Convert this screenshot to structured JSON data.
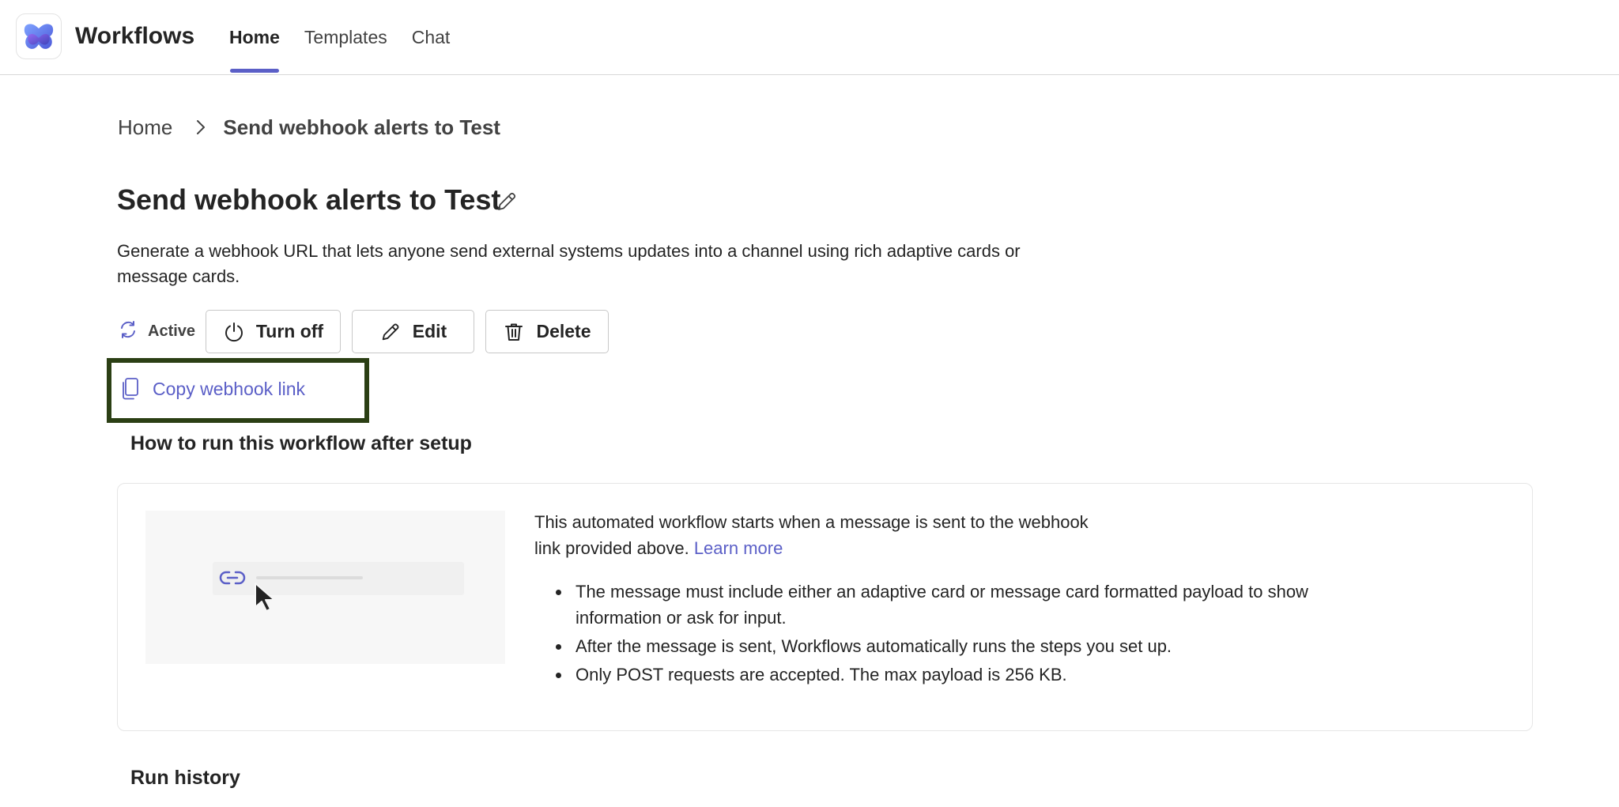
{
  "header": {
    "app_title": "Workflows",
    "tabs": [
      {
        "label": "Home",
        "active": true
      },
      {
        "label": "Templates",
        "active": false
      },
      {
        "label": "Chat",
        "active": false
      }
    ]
  },
  "breadcrumb": {
    "home": "Home",
    "current": "Send webhook alerts to Test"
  },
  "page": {
    "title": "Send webhook alerts to Test",
    "description": "Generate a webhook URL that lets anyone send external systems updates into a channel using rich adaptive cards or message cards."
  },
  "actions": {
    "status": "Active",
    "turn_off": "Turn off",
    "edit": "Edit",
    "delete": "Delete",
    "copy_link": "Copy webhook link"
  },
  "howto": {
    "title": "How to run this workflow after setup",
    "intro": "This automated workflow starts when a message is sent to the webhook link provided above.",
    "learn_more": "Learn more",
    "bullets": [
      "The message must include either an adaptive card or message card formatted payload to show information or ask for input.",
      "After the message is sent, Workflows automatically runs the steps you set up.",
      "Only POST requests are accepted. The max payload is 256 KB."
    ]
  },
  "run_history": {
    "title": "Run history"
  },
  "colors": {
    "accent": "#5b5fc7",
    "highlight_border": "#2b3f14",
    "text": "#242424"
  },
  "icons": {
    "logo": "workflows-logo-icon",
    "edit_title": "pencil-icon",
    "status": "sync-icon",
    "turn_off": "power-icon",
    "edit": "pencil-icon",
    "delete": "trash-icon",
    "copy": "copy-icon",
    "breadcrumb_separator": "chevron-right-icon"
  }
}
